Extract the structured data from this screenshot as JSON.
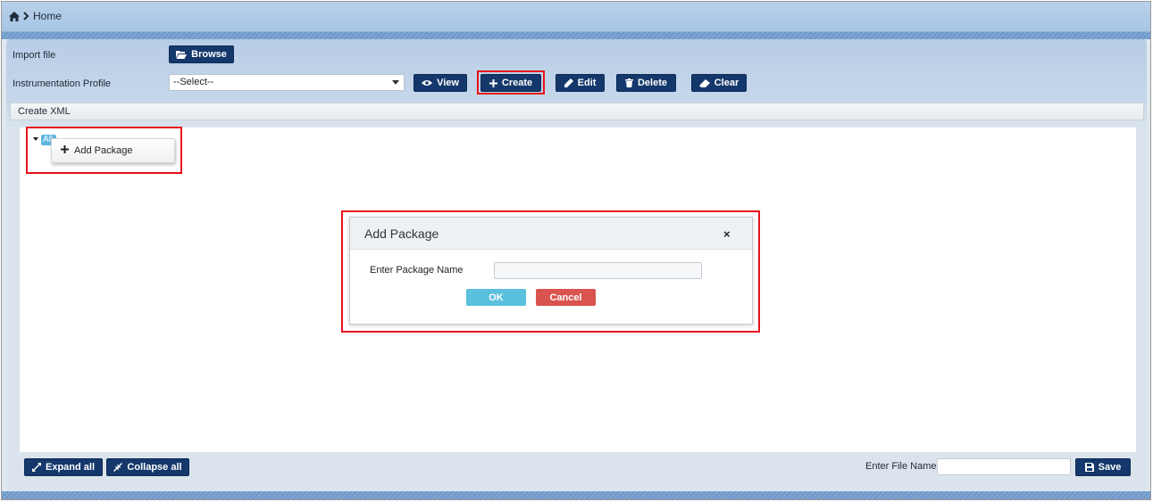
{
  "breadcrumb": {
    "home_label": "Home"
  },
  "form": {
    "import_label": "Import file",
    "browse_label": "Browse",
    "profile_label": "Instrumentation Profile",
    "profile_value": "--Select--",
    "buttons": {
      "view": "View",
      "create": "Create",
      "edit": "Edit",
      "delete": "Delete",
      "clear": "Clear"
    }
  },
  "create_xml": {
    "header": "Create XML",
    "tree_root": "All",
    "context_menu": {
      "add_package": "Add Package"
    }
  },
  "modal": {
    "title": "Add Package",
    "close": "×",
    "field_label": "Enter Package Name",
    "field_value": "",
    "ok": "OK",
    "cancel": "Cancel"
  },
  "footer": {
    "expand_all": "Expand all",
    "collapse_all": "Collapse all",
    "file_name_label": "Enter File Name",
    "file_name_value": "",
    "save": "Save"
  },
  "colors": {
    "primary_button": "#14386b",
    "ok_button": "#5bc0de",
    "cancel_button": "#d9534f",
    "highlight": "#e8111b",
    "tree_node": "#5bb6de"
  },
  "icons": [
    "home-icon",
    "chevron-right-icon",
    "folder-open-icon",
    "eye-icon",
    "plus-icon",
    "pencil-icon",
    "trash-icon",
    "eraser-icon",
    "expand-icon",
    "collapse-icon",
    "save-icon",
    "close-icon"
  ]
}
